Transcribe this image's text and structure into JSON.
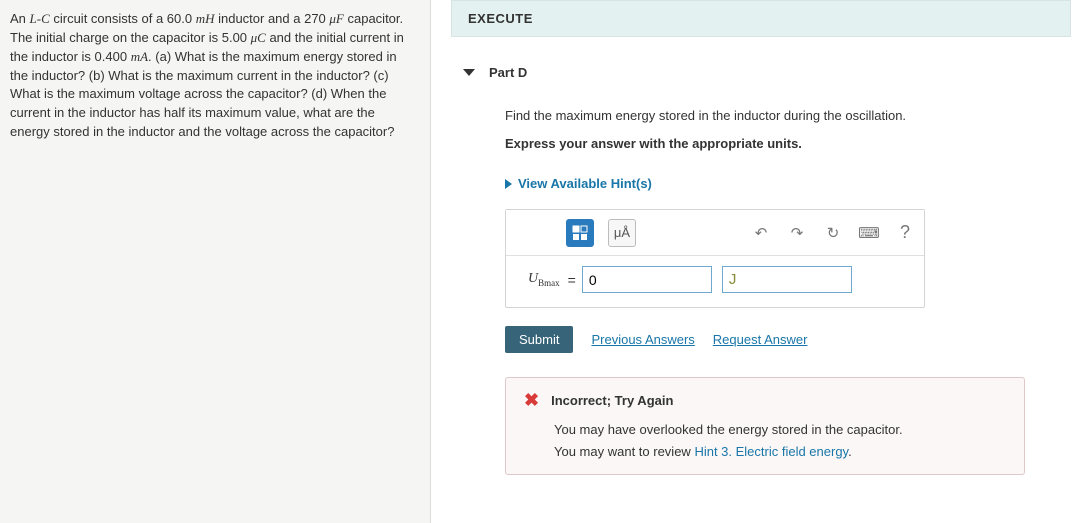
{
  "problem_text_parts": {
    "p_start": "An ",
    "LC": "L-C",
    "p_a": " circuit consists of a 60.0 ",
    "mH": "mH",
    "p_b": " inductor and a 270 ",
    "uF": "μF",
    "p_c": " capacitor. The initial charge on the capacitor is 5.00 ",
    "uC": "μC",
    "p_d": " and the initial current in the inductor is 0.400 ",
    "mA": "mA",
    "p_e": ". (a) What is the maximum energy stored in the inductor? (b) What is the maximum current in the inductor? (c) What is the maximum voltage across the capacitor? (d) When the current in the inductor has half its maximum value, what are the energy stored in the inductor and the voltage across the capacitor?"
  },
  "execute_label": "EXECUTE",
  "part": {
    "label": "Part D",
    "prompt_line1": "Find the maximum energy stored in the inductor during the oscillation.",
    "prompt_line2": "Express your answer with the appropriate units.",
    "hints_label": "View Available Hint(s)"
  },
  "toolbar": {
    "xfrac": "X÷",
    "mu_a": "μÅ",
    "undo": "↶",
    "redo": "↷",
    "reset": "↻",
    "keyboard": "⌨",
    "help": "?"
  },
  "answer": {
    "var": "U",
    "var_sub": "Bmax",
    "equals": "=",
    "value": "0",
    "unit": "J"
  },
  "submit_row": {
    "submit": "Submit",
    "prev": "Previous Answers",
    "req": "Request Answer"
  },
  "feedback": {
    "head": "Incorrect; Try Again",
    "line1": "You may have overlooked the energy stored in the capacitor.",
    "line2_a": "You may want to review ",
    "hint_link": "Hint 3. Electric field energy",
    "line2_b": "."
  }
}
